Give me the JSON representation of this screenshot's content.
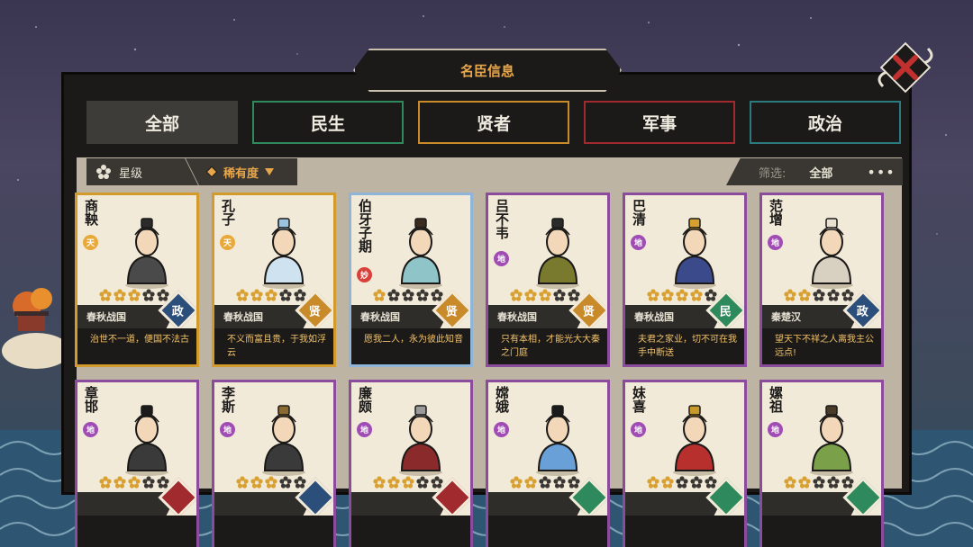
{
  "title": "名臣信息",
  "tabs": [
    {
      "label": "全部",
      "color": "#3e3c38",
      "active": true
    },
    {
      "label": "民生",
      "color": "#2e8a5c"
    },
    {
      "label": "贤者",
      "color": "#c98a2a"
    },
    {
      "label": "军事",
      "color": "#a02a2e"
    },
    {
      "label": "政治",
      "color": "#2a7a80"
    }
  ],
  "filter": {
    "star_label": "星级",
    "rarity_label": "稀有度",
    "filter_label": "筛选:",
    "filter_value": "全部",
    "more": "•••"
  },
  "colors": {
    "gold": "#d39a2c",
    "blue": "#8fb5d9",
    "purple": "#8c4c9e",
    "zheng": "#2c4e7a",
    "xian": "#c98a2a",
    "min": "#2e8a5c",
    "tian": "#e8a93a",
    "di": "#a04cb4",
    "miao": "#d8403a"
  },
  "cards": [
    {
      "name": "商鞅",
      "badge": "天",
      "badge_color": "#e8a93a",
      "border": "#d39a2c",
      "stars": 3,
      "era": "春秋战国",
      "category": "政",
      "cat_color": "#2c4e7a",
      "quote": "治世不一道，便国不法古",
      "robe": "#4a4a4a",
      "hat": "#2b2b2b"
    },
    {
      "name": "孔子",
      "badge": "天",
      "badge_color": "#e8a93a",
      "border": "#d39a2c",
      "stars": 3,
      "era": "春秋战国",
      "category": "贤",
      "cat_color": "#c98a2a",
      "quote": "不义而富且贵，于我如浮云",
      "robe": "#cfe2ef",
      "hat": "#9cc4e0"
    },
    {
      "name": "伯牙子期",
      "badge": "妙",
      "badge_color": "#d8403a",
      "border": "#8fb5d9",
      "stars": 1,
      "era": "春秋战国",
      "category": "贤",
      "cat_color": "#c98a2a",
      "quote": "愿我二人，永为彼此知音",
      "robe": "#8fc4c8",
      "hat": "#3a2a20"
    },
    {
      "name": "吕不韦",
      "badge": "地",
      "badge_color": "#a04cb4",
      "border": "#8c4c9e",
      "stars": 3,
      "era": "春秋战国",
      "category": "贤",
      "cat_color": "#c98a2a",
      "quote": "只有本相，才能光大大秦之门庭",
      "robe": "#7a7a2e",
      "hat": "#2b2b2b"
    },
    {
      "name": "巴清",
      "badge": "地",
      "badge_color": "#a04cb4",
      "border": "#8c4c9e",
      "stars": 4,
      "era": "春秋战国",
      "category": "民",
      "cat_color": "#2e8a5c",
      "quote": "夫君之家业，切不可在我手中断送",
      "robe": "#3a4a8a",
      "hat": "#d8a030"
    },
    {
      "name": "范增",
      "badge": "地",
      "badge_color": "#a04cb4",
      "border": "#8c4c9e",
      "stars": 2,
      "era": "秦楚汉",
      "category": "政",
      "cat_color": "#2c4e7a",
      "quote": "望天下不祥之人离我主公远点!",
      "robe": "#d8d0c0",
      "hat": "#e8e0d0"
    },
    {
      "name": "章邯",
      "badge": "地",
      "badge_color": "#a04cb4",
      "border": "#8c4c9e",
      "stars": 3,
      "era": "",
      "category": "",
      "cat_color": "#a02a2e",
      "quote": "",
      "robe": "#3a3a3a",
      "hat": "#1b1b1b"
    },
    {
      "name": "李斯",
      "badge": "地",
      "badge_color": "#a04cb4",
      "border": "#8c4c9e",
      "stars": 3,
      "era": "",
      "category": "",
      "cat_color": "#2c4e7a",
      "quote": "",
      "robe": "#3a3a3a",
      "hat": "#8a6a30"
    },
    {
      "name": "廉颇",
      "badge": "地",
      "badge_color": "#a04cb4",
      "border": "#8c4c9e",
      "stars": 3,
      "era": "",
      "category": "",
      "cat_color": "#a02a2e",
      "quote": "",
      "robe": "#8a2a2a",
      "hat": "#9a9a9a"
    },
    {
      "name": "嫦娥",
      "badge": "地",
      "badge_color": "#a04cb4",
      "border": "#8c4c9e",
      "stars": 2,
      "era": "",
      "category": "",
      "cat_color": "#2e8a5c",
      "quote": "",
      "robe": "#6aa0d8",
      "hat": "#1b1b1b"
    },
    {
      "name": "妺喜",
      "badge": "地",
      "badge_color": "#a04cb4",
      "border": "#8c4c9e",
      "stars": 2,
      "era": "",
      "category": "",
      "cat_color": "#2e8a5c",
      "quote": "",
      "robe": "#b8302e",
      "hat": "#c89a2a"
    },
    {
      "name": "嫘祖",
      "badge": "地",
      "badge_color": "#a04cb4",
      "border": "#8c4c9e",
      "stars": 2,
      "era": "",
      "category": "",
      "cat_color": "#2e8a5c",
      "quote": "",
      "robe": "#7aa04a",
      "hat": "#4a3a2a"
    }
  ]
}
